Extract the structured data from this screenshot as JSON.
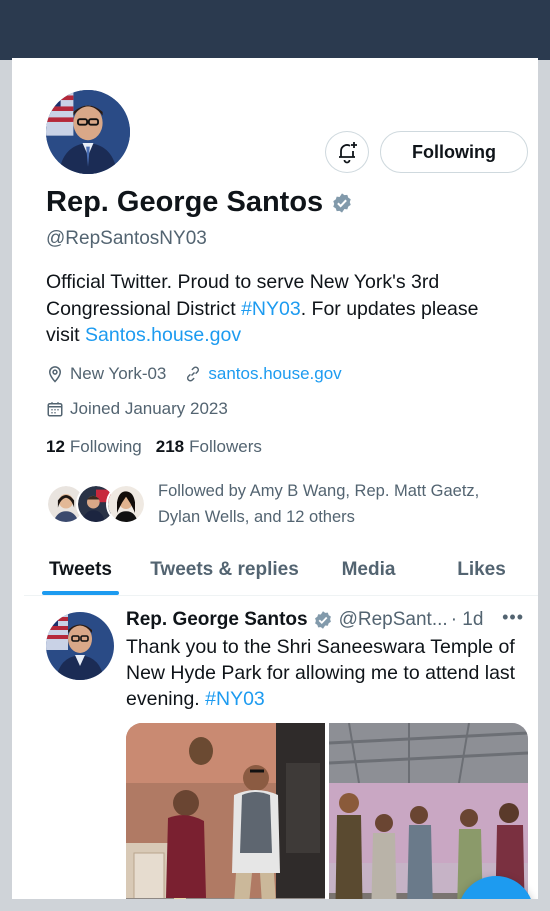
{
  "profile": {
    "display_name": "Rep. George Santos",
    "handle": "@RepSantosNY03",
    "bio_part1": "Official Twitter. Proud to serve New York's 3rd Congressional District ",
    "bio_hashtag": "#NY03",
    "bio_part2": ". For updates please visit ",
    "bio_link": "Santos.house.gov",
    "location": "New York-03",
    "website": "santos.house.gov",
    "joined": "Joined January 2023",
    "following_count": "12",
    "following_label": "Following",
    "followers_count": "218",
    "followers_label": "Followers",
    "followed_by": "Followed by Amy B Wang, Rep. Matt Gaetz, Dylan Wells, and 12 others"
  },
  "actions": {
    "following_label": "Following",
    "notify_icon": "bell-plus-icon"
  },
  "tabs": [
    {
      "label": "Tweets",
      "active": true
    },
    {
      "label": "Tweets & replies",
      "active": false
    },
    {
      "label": "Media",
      "active": false
    },
    {
      "label": "Likes",
      "active": false
    }
  ],
  "tweet": {
    "name": "Rep. George Santos",
    "handle": "@RepSant...",
    "time": "· 1d",
    "more": "•••",
    "text_part1": "Thank you to the Shri Saneeswara Temple of New Hyde Park for allowing me to attend last evening. ",
    "hashtag": "#NY03"
  },
  "colors": {
    "accent": "#1d9bf0",
    "text_primary": "#0f1419",
    "text_secondary": "#536471"
  }
}
